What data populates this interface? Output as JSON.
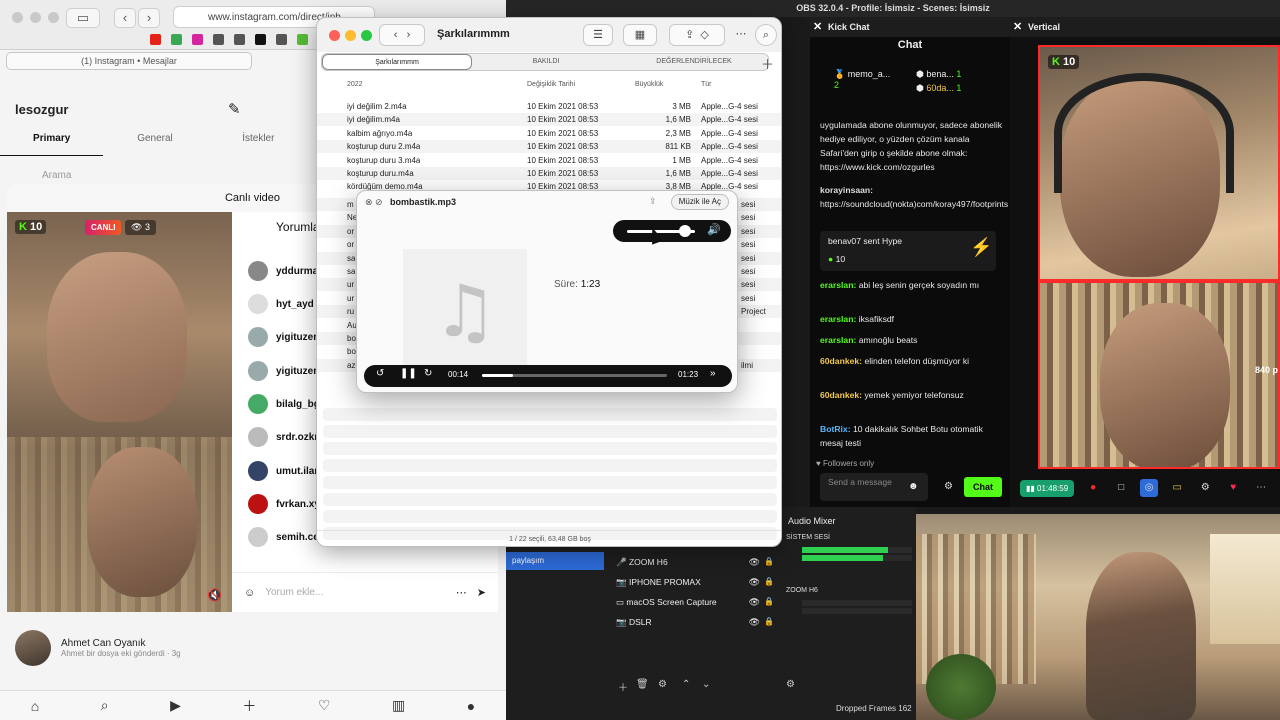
{
  "browser": {
    "url": "www.instagram.com/direct/inb",
    "tab_label": "(1) Instagram • Mesajlar",
    "username": "lesozgur",
    "tabs": [
      "Primary",
      "General",
      "İstekler"
    ],
    "search_placeholder": "Arama",
    "live_title": "Canlı video",
    "live_badge": "CANLI",
    "live_viewers": "3",
    "kick_count": "10",
    "comments_header": "Yorumla",
    "commenters": [
      "yddurma",
      "hyt_ayd l",
      "yigituzen",
      "yigituzen",
      "bilalg_bg",
      "srdr.ozkr",
      "umut.ilan",
      "fvrkan.xy",
      "semih.cel"
    ],
    "comment_placeholder": "Yorum ekle...",
    "dm_name": "Ahmet Can Oyanık",
    "dm_sub": "Ahmet bir dosya eki gönderdi · 3g"
  },
  "finder": {
    "title": "Şarkılarımmm",
    "tabs": [
      "Şarkılarımmm",
      "BAKILDI",
      "DEĞERLENDİRİLECEK"
    ],
    "columns": {
      "name": "2022",
      "date": "Değişiklik Tarihi",
      "size": "Büyüklük",
      "kind": "Tür"
    },
    "files": [
      {
        "name": "iyi değilim 2.m4a",
        "date": "10 Ekim 2021 08:53",
        "size": "3 MB",
        "kind": "Apple...G-4 sesi"
      },
      {
        "name": "iyi değilim.m4a",
        "date": "10 Ekim 2021 08:53",
        "size": "1,6 MB",
        "kind": "Apple...G-4 sesi"
      },
      {
        "name": "kalbim ağrıyo.m4a",
        "date": "10 Ekim 2021 08:53",
        "size": "2,3 MB",
        "kind": "Apple...G-4 sesi"
      },
      {
        "name": "koşturup duru 2.m4a",
        "date": "10 Ekim 2021 08:53",
        "size": "811 KB",
        "kind": "Apple...G-4 sesi"
      },
      {
        "name": "koşturup duru 3.m4a",
        "date": "10 Ekim 2021 08:53",
        "size": "1 MB",
        "kind": "Apple...G-4 sesi"
      },
      {
        "name": "koşturup duru.m4a",
        "date": "10 Ekim 2021 08:53",
        "size": "1,6 MB",
        "kind": "Apple...G-4 sesi"
      },
      {
        "name": "kördüğüm demo.m4a",
        "date": "10 Ekim 2021 08:53",
        "size": "3,8 MB",
        "kind": "Apple...G-4 sesi"
      }
    ],
    "partial_rows": [
      "m",
      "Ne",
      "or",
      "or",
      "sa",
      "sa",
      "ur",
      "ur",
      "ru",
      "Au",
      "bo",
      "bo",
      "az"
    ],
    "partial_kinds": [
      "sesi",
      "sesi",
      "sesi",
      "sesi",
      "sesi",
      "sesi",
      "sesi",
      "sesi",
      "Project",
      "",
      "",
      "",
      "ilmi"
    ],
    "status": "1 / 22 seçili, 63,48 GB boş"
  },
  "player": {
    "filename": "bombastik.mp3",
    "open_with": "Müzik ile Aç",
    "duration_label": "Süre:",
    "duration": "1:23",
    "elapsed": "00:14",
    "total": "01:23",
    "progress": 0.17,
    "volume": 0.85
  },
  "obs": {
    "title": "OBS 32.0.4 - Profile: İsimsiz - Scenes: İsimsiz",
    "scene_selected": "paylaşım",
    "sources": [
      "ZOOM H6",
      "IPHONE PROMAX",
      "macOS Screen Capture",
      "DSLR"
    ],
    "mixer_title": "Audio Mixer",
    "mixer_channels": [
      "SİSTEM SESİ",
      "ZOOM H6"
    ],
    "dropped": "Dropped Frames 162"
  },
  "kick_chat": {
    "panel_title": "Kick Chat",
    "header": "Chat",
    "leaderboard": [
      {
        "name": "memo_a...",
        "rank": "1",
        "count": "2"
      },
      {
        "name": "bena...",
        "count": "1"
      },
      {
        "name": "60da...",
        "count": "1"
      }
    ],
    "messages": [
      {
        "user": "",
        "text": "uygulamada abone olunmuyor, sadece abonelik hediye ediliyor, o yüzden çözüm kanala Safari'den girip o şekilde abone olmak: https://www.kick.com/ozgurles"
      },
      {
        "user": "korayinsaan:",
        "text": "https://soundcloud(nokta)com/koray497/footprints"
      },
      {
        "user": "erarslan:",
        "text": "abi leş senin gerçek soyadın mı"
      },
      {
        "user": "erarslan:",
        "text": "iksafiksdf"
      },
      {
        "user": "erarslan:",
        "text": "amınoğlu beats"
      },
      {
        "user": "60dankek:",
        "text": "elinden telefon düşmüyor ki"
      },
      {
        "user": "60dankek:",
        "text": "yemek yemiyor telefonsuz"
      },
      {
        "user": "BotRix:",
        "text": "10 dakikalık Sohbet Botu otomatik mesaj testi"
      }
    ],
    "hype_text": "benav07 sent Hype",
    "hype_count": "10",
    "followers_only": "Followers only",
    "input_placeholder": "Send a message",
    "send_label": "Chat"
  },
  "vertical": {
    "panel_title": "Vertical",
    "kick_count": "10",
    "size_label": "840 p",
    "rec_time": "01:48:59"
  },
  "colors": {
    "kick_green": "#53fc18",
    "rec_red": "#ff2a2a",
    "obs_scene_blue": "#2d6bd8"
  }
}
